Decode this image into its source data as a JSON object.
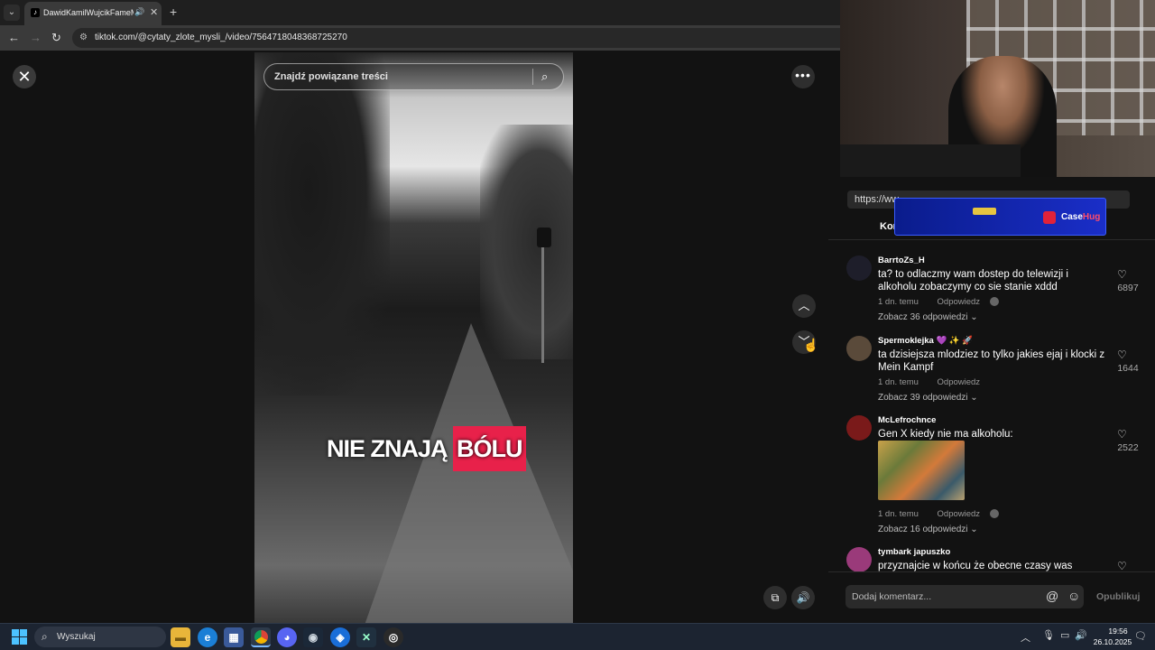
{
  "browser": {
    "tab_title": "DawidKamilWujcikFameMMA",
    "url": "tiktok.com/@cytaty_zlote_mysli_/video/7564718048368725270"
  },
  "viewer": {
    "search_placeholder": "Znajdź powiązane treści",
    "caption_part1": "NIE ZNAJĄ ",
    "caption_part2": "BÓLU"
  },
  "overlay": {
    "url_strip": "https://ww...",
    "banner_brand_1": "Case",
    "banner_brand_2": "Hug",
    "tab_label": "Kom"
  },
  "comments": [
    {
      "user": "BarrtoZs_H",
      "text": "ta? to odlaczmy wam dostep do telewizji i alkoholu zobaczymy co sie stanie xddd",
      "time": "1 dn. temu",
      "reply": "Odpowiedz",
      "replies": "Zobacz 36 odpowiedzi",
      "likes": "6897"
    },
    {
      "user": "Spermoklejka",
      "text": "ta dzisiejsza mlodziez to tylko jakies ejaj i klocki z Mein Kampf",
      "time": "1 dn. temu",
      "reply": "Odpowiedz",
      "replies": "Zobacz 39 odpowiedzi",
      "likes": "1644"
    },
    {
      "user": "McLefrochnce",
      "text": "Gen X kiedy nie ma alkoholu:",
      "time": "1 dn. temu",
      "reply": "Odpowiedz",
      "replies": "Zobacz 16 odpowiedzi",
      "likes": "2522"
    },
    {
      "user": "tymbark japuszko",
      "text": "przyznajcie w końcu że obecne czasy was poprostu"
    }
  ],
  "comment_input": {
    "placeholder": "Dodaj komentarz...",
    "publish": "Opublikuj"
  },
  "taskbar": {
    "search_placeholder": "Wyszukaj",
    "time": "19:56",
    "date": "26.10.2025"
  },
  "colors": {
    "caption_highlight": "#e8214a",
    "background": "#121212",
    "taskbar": "#1c2431"
  }
}
